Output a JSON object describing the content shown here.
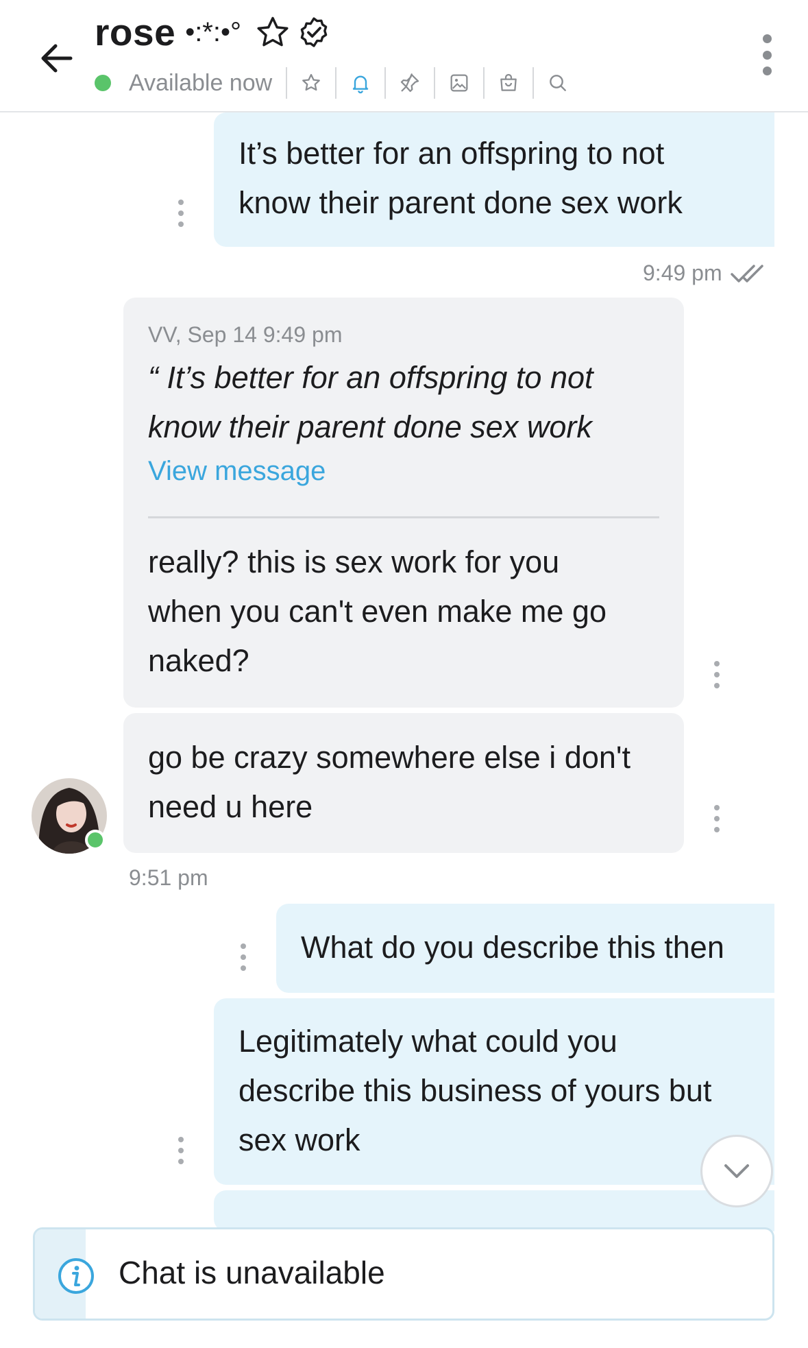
{
  "header": {
    "contact_name": "rose",
    "name_decoration": "•:*:•°",
    "status": "Available now",
    "icons": [
      "back-arrow-icon",
      "star-icon",
      "verified-badge-icon",
      "star-outline-icon",
      "bell-icon",
      "pin-icon",
      "image-icon",
      "shopping-bag-icon",
      "search-icon",
      "more-vertical-icon"
    ],
    "accent_color": "#3aa6dd",
    "online_color": "#5ac46a"
  },
  "messages": [
    {
      "id": "m1",
      "direction": "out",
      "lines": [
        "It’s better for an offspring to not",
        "know their parent done sex work"
      ],
      "time": "9:49 pm"
    },
    {
      "id": "m2",
      "direction": "in",
      "quote": {
        "meta": "VV, Sep 14 9:49 pm",
        "lines": [
          "“ It’s better for an offspring to not",
          "know their parent done sex work"
        ],
        "link": "View message"
      },
      "lines": [
        "really? this is sex work for you",
        "when you can't even make me go",
        "naked?"
      ]
    },
    {
      "id": "m3",
      "direction": "in",
      "lines": [
        "go be crazy somewhere else i don't",
        "need u here"
      ],
      "time": "9:51 pm"
    },
    {
      "id": "m4",
      "direction": "out",
      "lines": [
        "What do you describe this then"
      ]
    },
    {
      "id": "m5",
      "direction": "out",
      "lines": [
        "Legitimately what could you",
        "describe this business of yours but",
        "sex work"
      ]
    }
  ],
  "bottom_bar": {
    "text": "Chat is unavailable",
    "icon": "info-icon"
  },
  "colors": {
    "outgoing_bubble": "#e5f4fb",
    "incoming_bubble": "#f1f2f4"
  }
}
